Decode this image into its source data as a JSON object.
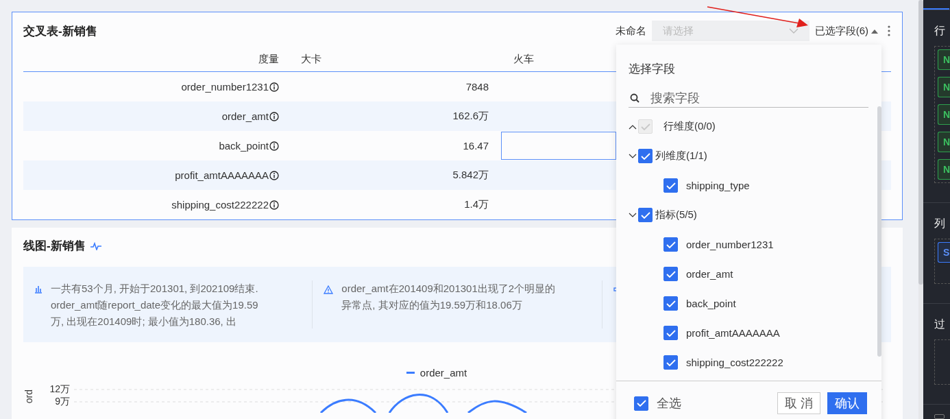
{
  "table_card": {
    "title": "交叉表-新销售",
    "name_label": "未命名",
    "select": {
      "placeholder": "请选择"
    },
    "fields_toggle": {
      "label": "已选字段(6)",
      "expanded": true
    },
    "columns": [
      "度量",
      "大卡",
      "火车"
    ],
    "rows": [
      {
        "measure": "order_number1231",
        "value": "7848",
        "selected": false
      },
      {
        "measure": "order_amt",
        "value": "162.6万",
        "selected": false
      },
      {
        "measure": "back_point",
        "value": "16.47",
        "selected": true
      },
      {
        "measure": "profit_amtAAAAAAA",
        "value": "5.842万",
        "selected": false
      },
      {
        "measure": "shipping_cost222222",
        "value": "1.4万",
        "selected": false
      }
    ]
  },
  "line_card": {
    "title": "线图-新销售",
    "insights": [
      {
        "kind": "bars",
        "text": "一共有53个月, 开始于201301, 到202109结束. order_amt随report_date变化的最大值为19.59万, 出现在201409时; 最小值为180.36, 出"
      },
      {
        "kind": "warning",
        "text": "order_amt在201409和201301出现了2个明显的异常点, 其对应的值为19.59万和18.06万"
      },
      {
        "kind": "flow"
      }
    ],
    "legend": "order_amt",
    "y_axis_title": "ord",
    "y_ticks": [
      "12万",
      "9万"
    ]
  },
  "field_picker": {
    "title": "选择字段",
    "search": {
      "placeholder": "搜索字段"
    },
    "groups": [
      {
        "label": "行维度(0/0)",
        "expanded": false,
        "checked": true,
        "disabled": true
      },
      {
        "label": "列维度(1/1)",
        "expanded": true,
        "checked": true,
        "disabled": false,
        "children": [
          {
            "label": "shipping_type",
            "checked": true
          }
        ]
      },
      {
        "label": "指标(5/5)",
        "expanded": true,
        "checked": true,
        "disabled": false,
        "children": [
          {
            "label": "order_number1231",
            "checked": true
          },
          {
            "label": "order_amt",
            "checked": true
          },
          {
            "label": "back_point",
            "checked": true
          },
          {
            "label": "profit_amtAAAAAAA",
            "checked": true
          },
          {
            "label": "shipping_cost222222",
            "checked": true
          }
        ]
      }
    ],
    "select_all": {
      "label": "全选",
      "checked": true
    },
    "cancel": "取 消",
    "confirm": "确认"
  },
  "side_panel": {
    "sections": [
      {
        "label": "行",
        "tags": [
          {
            "text": "N",
            "kind": "dimension"
          },
          {
            "text": "N",
            "kind": "dimension"
          },
          {
            "text": "N",
            "kind": "dimension"
          },
          {
            "text": "N",
            "kind": "dimension"
          },
          {
            "text": "N",
            "kind": "dimension"
          }
        ]
      },
      {
        "label": "列",
        "tags": [
          {
            "text": "S",
            "kind": "measure"
          }
        ]
      },
      {
        "label": "过"
      }
    ],
    "checkbox": {
      "checked": false
    }
  }
}
